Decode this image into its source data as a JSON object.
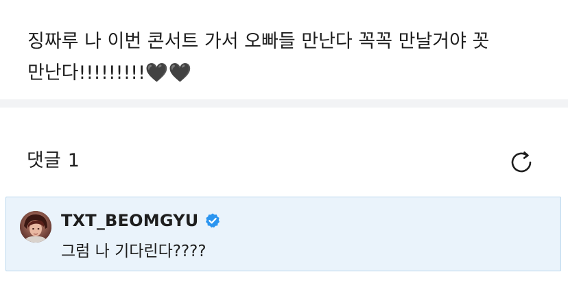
{
  "post": {
    "text": "징짜루 나 이번 콘서트 가서 오빠들 만난다 꼭꼭 만날거야 꼿 만난다!!!!!!!!!🖤🖤"
  },
  "comments": {
    "title": "댓글",
    "count": "1"
  },
  "comment": {
    "author": "TXT_BEOMGYU",
    "text": "그럼 나 기다린다????"
  },
  "icons": {
    "refresh": "refresh-icon",
    "verified": "verified-badge-icon",
    "avatar": "avatar-image"
  },
  "colors": {
    "highlight_bg": "#eaf3fb",
    "highlight_border": "#b9d7ee",
    "verified": "#2b95f0",
    "divider": "#f2f3f5"
  }
}
